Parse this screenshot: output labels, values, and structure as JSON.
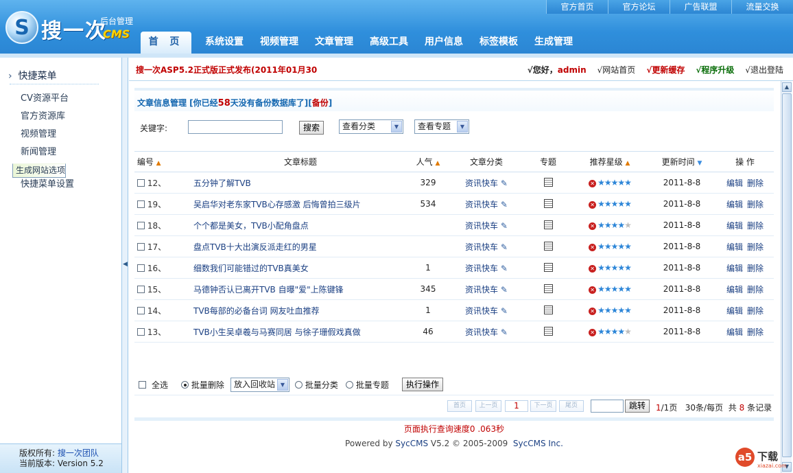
{
  "header": {
    "logo_main": "搜一次",
    "logo_sub": "后台管理",
    "logo_cms": "CMS",
    "top_links": [
      "官方首页",
      "官方论坛",
      "广告联盟",
      "流量交换"
    ],
    "nav": [
      "首 页",
      "系统设置",
      "视频管理",
      "文章管理",
      "高级工具",
      "用户信息",
      "标签模板",
      "生成管理"
    ]
  },
  "sidebar": {
    "title": "快捷菜单",
    "items": [
      "CV资源平台",
      "官方资源库",
      "视频管理",
      "新闻管理",
      "生成网站选项",
      "快捷菜单设置"
    ],
    "footer_copyright_label": "版权所有:",
    "footer_team": "搜一次团队",
    "footer_version": "当前版本: Version 5.2"
  },
  "infobar": {
    "announce": "搜一次ASP5.2正式版正式发布(2011年01月30",
    "greeting": "√您好，",
    "user": "admin",
    "site_home": "√网站首页",
    "refresh_cache": "√更新缓存",
    "upgrade": "√程序升级",
    "logout": "√退出登陆"
  },
  "panel": {
    "title_pre": "文章信息管理 [你已经",
    "title_days": "58",
    "title_post": "天没有备份数据库了][",
    "title_backup": "备份",
    "title_end": "]",
    "keyword_label": "关键字:",
    "search_button": "搜索",
    "category_select": "查看分类",
    "topic_select": "查看专题"
  },
  "table": {
    "headers": [
      "编号",
      "文章标题",
      "人气",
      "文章分类",
      "专题",
      "推荐星级",
      "更新时间",
      "操 作"
    ],
    "rows": [
      {
        "id": "12、",
        "title": "五分钟了解TVB",
        "views": "329",
        "category": "资讯快车",
        "stars": 5,
        "date": "2011-8-8"
      },
      {
        "id": "19、",
        "title": "吴启华对老东家TVB心存感激 后悔曾拍三级片",
        "views": "534",
        "category": "资讯快车",
        "stars": 5,
        "date": "2011-8-8"
      },
      {
        "id": "18、",
        "title": "个个都是美女，TVB小配角盘点",
        "views": "",
        "category": "资讯快车",
        "stars": 4,
        "date": "2011-8-8"
      },
      {
        "id": "17、",
        "title": "盘点TVB十大出演反派走红的男星",
        "views": "",
        "category": "资讯快车",
        "stars": 5,
        "date": "2011-8-8"
      },
      {
        "id": "16、",
        "title": "细数我们可能错过的TVB真美女",
        "views": "1",
        "category": "资讯快车",
        "stars": 5,
        "date": "2011-8-8"
      },
      {
        "id": "15、",
        "title": "马德钟否认已离开TVB 自曝\"爱\"上陈键锋",
        "views": "345",
        "category": "资讯快车",
        "stars": 5,
        "date": "2011-8-8"
      },
      {
        "id": "14、",
        "title": "TVB每部的必备台词 网友吐血推荐",
        "views": "1",
        "category": "资讯快车",
        "stars": 5,
        "date": "2011-8-8"
      },
      {
        "id": "13、",
        "title": "TVB小生吴卓羲与马赛同居 与徐子珊假戏真做",
        "views": "46",
        "category": "资讯快车",
        "stars": 4,
        "date": "2011-8-8"
      }
    ],
    "edit_label": "编辑",
    "delete_label": "删除"
  },
  "batch": {
    "select_all": "全选",
    "batch_delete": "批量删除",
    "recycle_select": "放入回收站",
    "batch_category": "批量分类",
    "batch_topic": "批量专题",
    "execute": "执行操作"
  },
  "pager": {
    "first": "首页",
    "prev": "上一页",
    "current": "1",
    "next": "下一页",
    "last": "尾页",
    "go": "跳转",
    "page_info_cur": "1",
    "page_info_rest": "/1页",
    "per_page": "30条/每页",
    "total_pre": "共",
    "total": "8",
    "total_post": "条记录"
  },
  "footer": {
    "exec_time": "页面执行查询速度0 .063秒",
    "powered_pre": "Powered by",
    "powered_brand": "SycCMS",
    "powered_mid": "V5.2 © 2005-2009",
    "powered_company": "SycCMS Inc."
  },
  "watermark": {
    "logo": "a5",
    "text": "下载",
    "url": "xiazai.com"
  }
}
